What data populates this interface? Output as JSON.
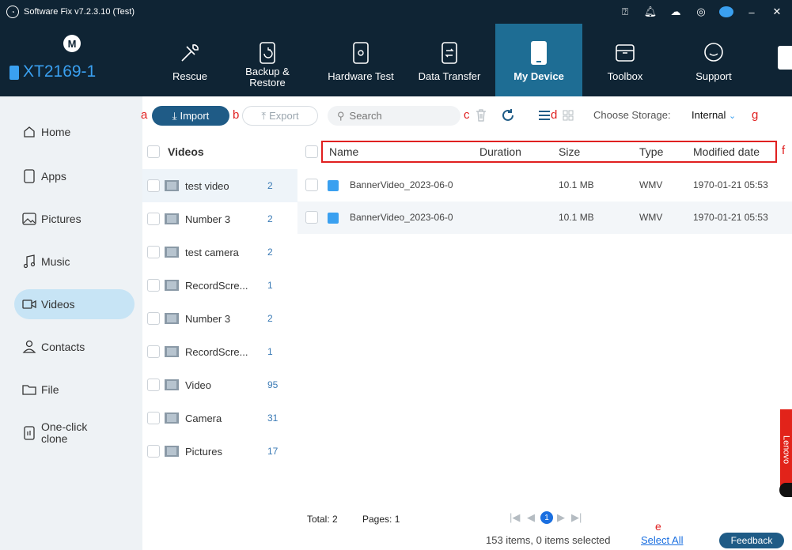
{
  "titlebar": {
    "title": "Software Fix v7.2.3.10 (Test)"
  },
  "device": {
    "name": "XT2169-1"
  },
  "nav": [
    {
      "label": "Rescue",
      "icon": "wrench-screwdriver-icon"
    },
    {
      "label": "Backup &\nRestore",
      "icon": "backup-restore-icon"
    },
    {
      "label": "Hardware Test",
      "icon": "hardware-test-icon"
    },
    {
      "label": "Data Transfer",
      "icon": "data-transfer-icon"
    },
    {
      "label": "My Device",
      "icon": "phone-icon"
    },
    {
      "label": "Toolbox",
      "icon": "toolbox-icon"
    },
    {
      "label": "Support",
      "icon": "chat-icon"
    }
  ],
  "sidebar": [
    {
      "label": "Home",
      "icon": "home-icon"
    },
    {
      "label": "Apps",
      "icon": "apps-icon"
    },
    {
      "label": "Pictures",
      "icon": "image-icon"
    },
    {
      "label": "Music",
      "icon": "music-icon"
    },
    {
      "label": "Videos",
      "icon": "video-icon"
    },
    {
      "label": "Contacts",
      "icon": "contact-icon"
    },
    {
      "label": "File",
      "icon": "folder-icon"
    },
    {
      "label": "One-click\nclone",
      "icon": "clone-icon"
    }
  ],
  "toolbar": {
    "import_label": "Import",
    "export_label": "Export",
    "search_placeholder": "Search",
    "storage_label": "Choose Storage:",
    "storage_value": "Internal"
  },
  "annotations": {
    "a": "a",
    "b": "b",
    "c": "c",
    "d": "d",
    "e": "e",
    "f": "f",
    "g": "g"
  },
  "folders": {
    "header": "Videos",
    "items": [
      {
        "name": "test video",
        "count": "2"
      },
      {
        "name": "Number 3",
        "count": "2"
      },
      {
        "name": "test camera",
        "count": "2"
      },
      {
        "name": "RecordScre...",
        "count": "1"
      },
      {
        "name": "Number 3",
        "count": "2"
      },
      {
        "name": "RecordScre...",
        "count": "1"
      },
      {
        "name": "Video",
        "count": "95"
      },
      {
        "name": "Camera",
        "count": "31"
      },
      {
        "name": "Pictures",
        "count": "17"
      }
    ]
  },
  "files": {
    "columns": {
      "name": "Name",
      "duration": "Duration",
      "size": "Size",
      "type": "Type",
      "modified": "Modified date"
    },
    "rows": [
      {
        "name": "BannerVideo_2023-06-0",
        "duration": "",
        "size": "10.1 MB",
        "type": "WMV",
        "modified": "1970-01-21 05:53"
      },
      {
        "name": "BannerVideo_2023-06-0",
        "duration": "",
        "size": "10.1 MB",
        "type": "WMV",
        "modified": "1970-01-21 05:53"
      }
    ]
  },
  "pager": {
    "total": "Total: 2",
    "pages": "Pages: 1",
    "current": "1"
  },
  "status": {
    "summary": "153 items, 0 items selected",
    "select_all": "Select All",
    "feedback": "Feedback"
  },
  "brand": {
    "lenovo": "Lenovo"
  }
}
